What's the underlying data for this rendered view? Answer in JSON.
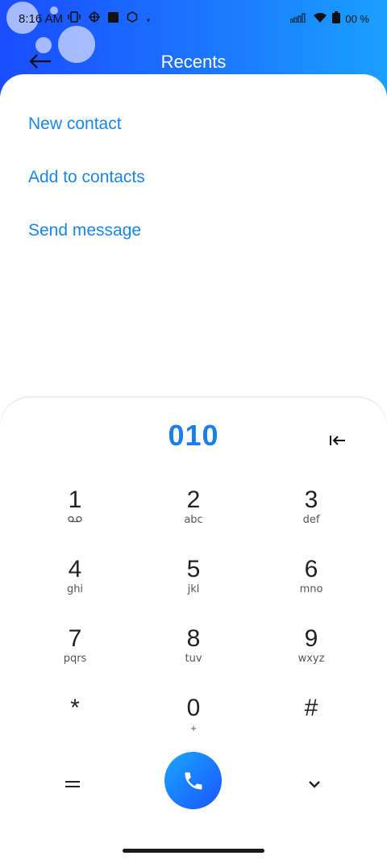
{
  "status_bar": {
    "time": "8:16 AM",
    "battery_text": "00 %",
    "icons_left": [
      "vibrate-icon",
      "target-icon",
      "square-icon",
      "app-icon",
      "dot-icon"
    ],
    "icons_right": [
      "signal-icon",
      "wifi-icon",
      "battery-icon"
    ]
  },
  "header": {
    "title": "Recents",
    "back_icon": "arrow-left-icon",
    "accent": "#1a6bff"
  },
  "actions": [
    {
      "label": "New contact"
    },
    {
      "label": "Add to contacts"
    },
    {
      "label": "Send message"
    }
  ],
  "dialpad": {
    "dialed_number": "010",
    "backspace_icon": "backspace-icon",
    "keys": [
      {
        "digit": "1",
        "letters": "",
        "icon": "voicemail-icon"
      },
      {
        "digit": "2",
        "letters": "abc"
      },
      {
        "digit": "3",
        "letters": "def"
      },
      {
        "digit": "4",
        "letters": "ghi"
      },
      {
        "digit": "5",
        "letters": "jkl"
      },
      {
        "digit": "6",
        "letters": "mno"
      },
      {
        "digit": "7",
        "letters": "pqrs"
      },
      {
        "digit": "8",
        "letters": "tuv"
      },
      {
        "digit": "9",
        "letters": "wxyz"
      },
      {
        "digit": "*",
        "letters": ""
      },
      {
        "digit": "0",
        "letters": "+"
      },
      {
        "digit": "#",
        "letters": ""
      }
    ],
    "call_icon": "phone-icon",
    "menu_icon": "menu-icon",
    "collapse_icon": "chevron-down-icon",
    "number_color": "#1a7fe6"
  }
}
